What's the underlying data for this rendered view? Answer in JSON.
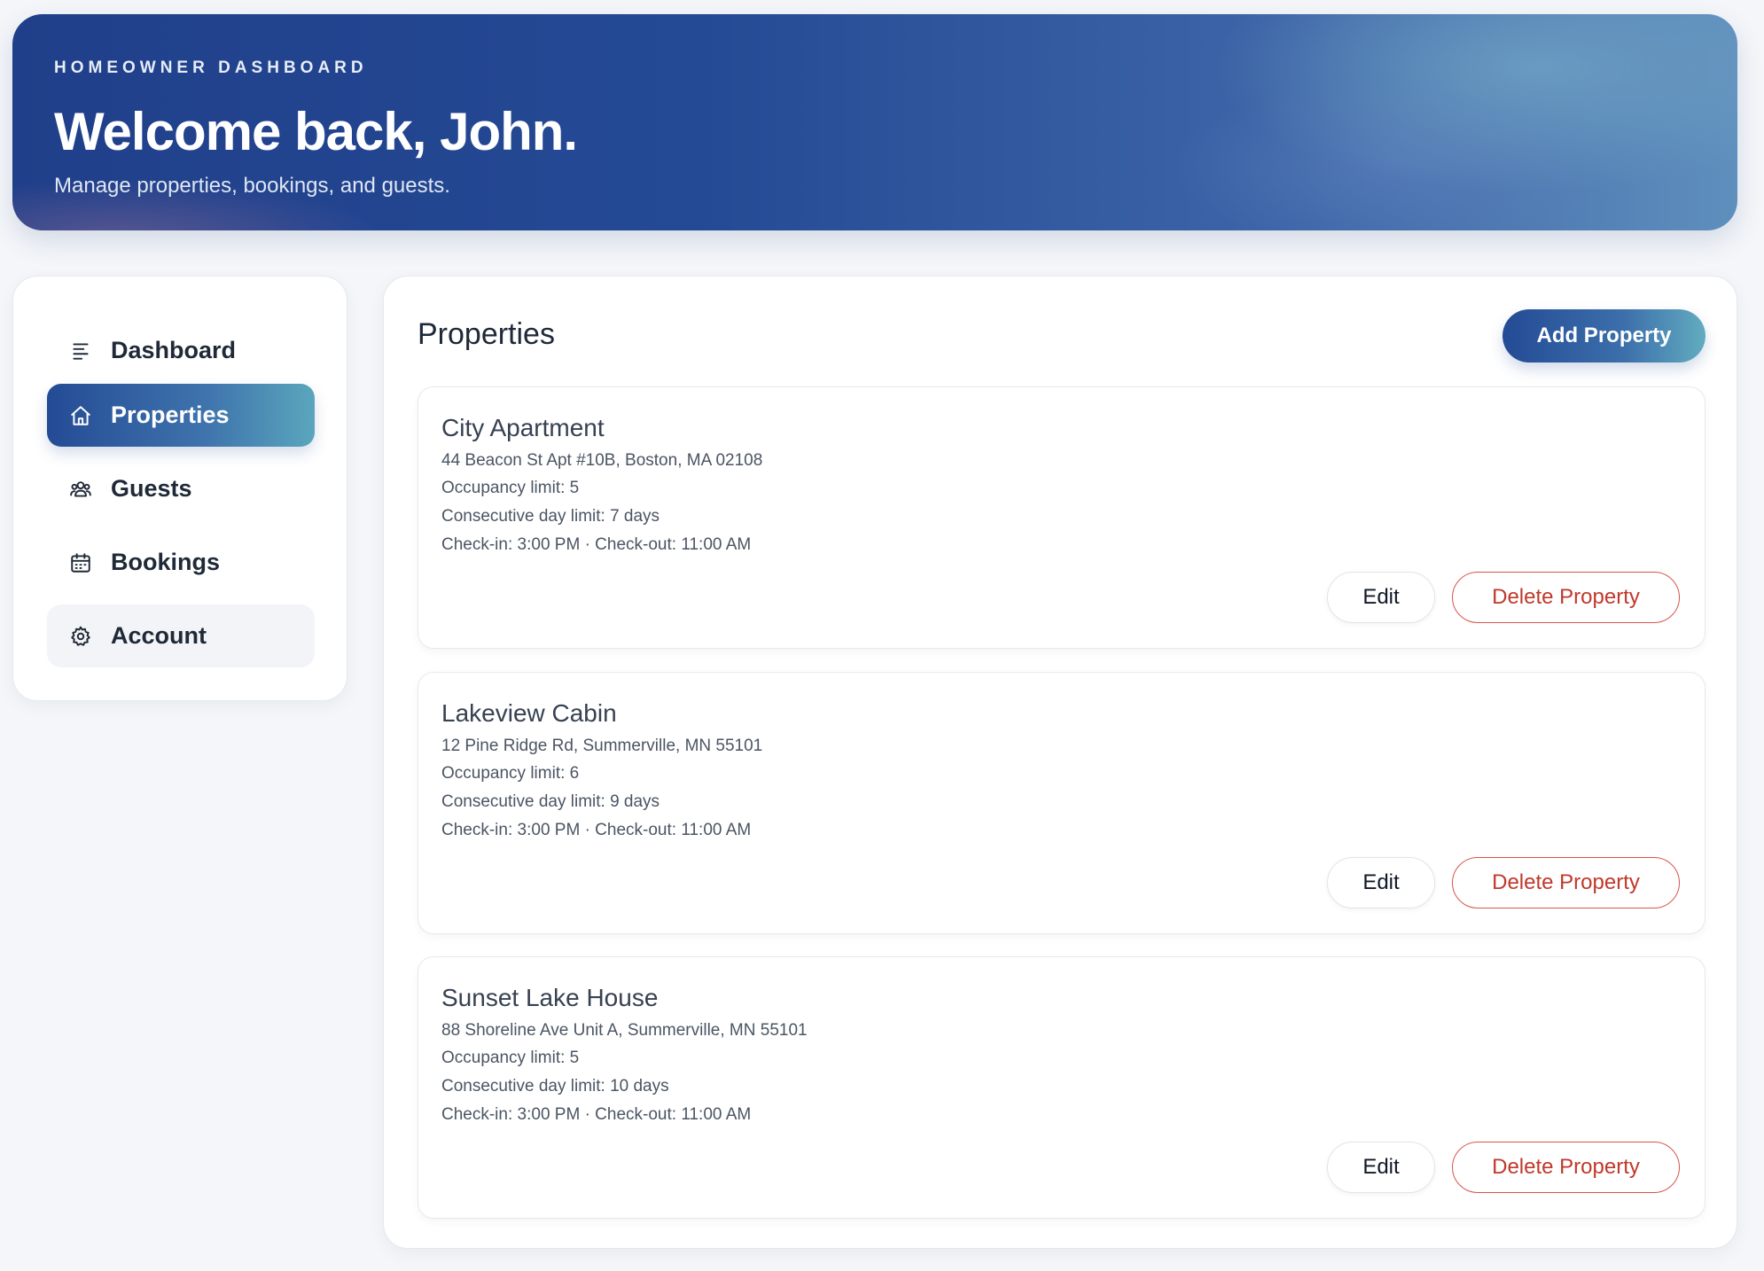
{
  "header": {
    "eyebrow": "HOMEOWNER DASHBOARD",
    "title": "Welcome back, John.",
    "subtitle": "Manage properties, bookings, and guests."
  },
  "sidebar": {
    "items": [
      {
        "label": "Dashboard",
        "icon": "list-icon",
        "state": "default"
      },
      {
        "label": "Properties",
        "icon": "home-icon",
        "state": "active"
      },
      {
        "label": "Guests",
        "icon": "users-icon",
        "state": "default"
      },
      {
        "label": "Bookings",
        "icon": "calendar-icon",
        "state": "default"
      },
      {
        "label": "Account",
        "icon": "gear-icon",
        "state": "muted"
      }
    ]
  },
  "main": {
    "title": "Properties",
    "add_button": "Add Property",
    "edit_label": "Edit",
    "delete_label": "Delete Property",
    "properties": [
      {
        "name": "City Apartment",
        "address": "44 Beacon St Apt #10B, Boston, MA 02108",
        "occupancy": "Occupancy limit: 5",
        "consecutive": "Consecutive day limit: 7 days",
        "checkin": "Check-in: 3:00 PM · Check-out: 11:00 AM"
      },
      {
        "name": "Lakeview Cabin",
        "address": "12 Pine Ridge Rd, Summerville, MN 55101",
        "occupancy": "Occupancy limit: 6",
        "consecutive": "Consecutive day limit: 9 days",
        "checkin": "Check-in: 3:00 PM · Check-out: 11:00 AM"
      },
      {
        "name": "Sunset Lake House",
        "address": "88 Shoreline Ave Unit A, Summerville, MN 55101",
        "occupancy": "Occupancy limit: 5",
        "consecutive": "Consecutive day limit: 10 days",
        "checkin": "Check-in: 3:00 PM · Check-out: 11:00 AM"
      }
    ]
  },
  "colors": {
    "brand_dark": "#244b95",
    "brand_light": "#5aa6bd",
    "danger": "#c0392b",
    "background": "#f4f6f9"
  }
}
